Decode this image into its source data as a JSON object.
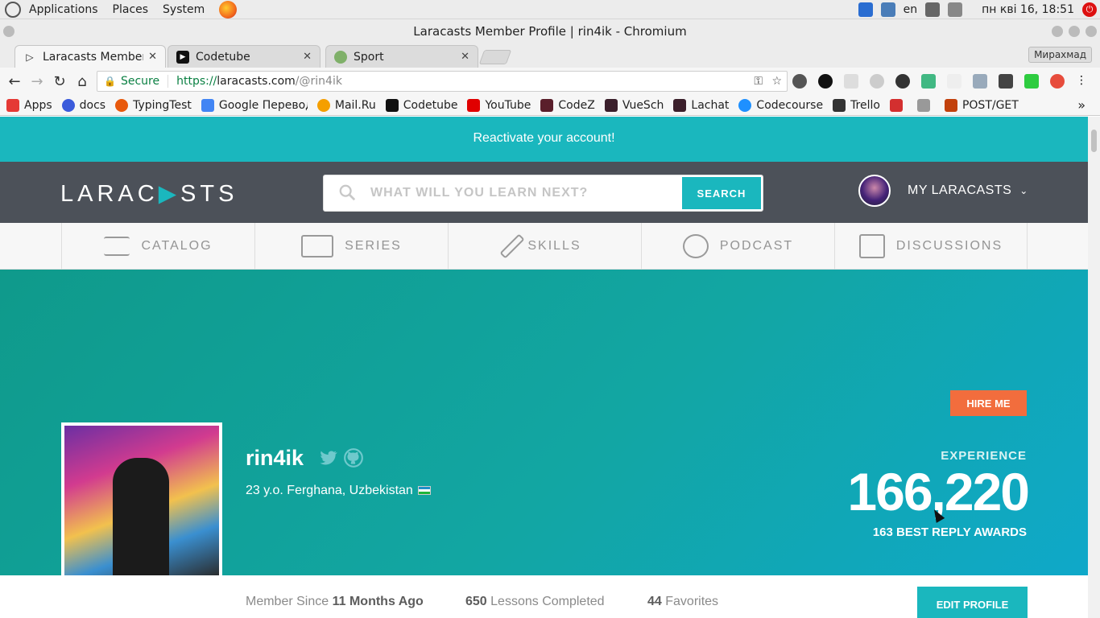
{
  "os": {
    "menus": [
      "Applications",
      "Places",
      "System"
    ],
    "keyboard_layout": "en",
    "datetime": "пн кві 16, 18:51"
  },
  "window": {
    "title": "Laracasts Member Profile | rin4ik - Chromium"
  },
  "tabs": [
    {
      "label": "Laracasts Member P",
      "icon": "laracasts-icon",
      "active": true
    },
    {
      "label": "Codetube",
      "icon": "youtube-icon",
      "active": false
    },
    {
      "label": "Sport",
      "icon": "sport-icon",
      "active": false
    }
  ],
  "profile_chip": "Мирахмад",
  "address_bar": {
    "secure_label": "Secure",
    "scheme": "https://",
    "host": "laracasts.com",
    "path": "/@rin4ik"
  },
  "bookmarks": [
    {
      "label": "Apps",
      "icon": "apps-icon",
      "color": "#e53935"
    },
    {
      "label": "docs",
      "icon": "docs-icon",
      "color": "#3b5bdb"
    },
    {
      "label": "TypingTest",
      "icon": "typingtest-icon",
      "color": "#e8590c"
    },
    {
      "label": "Google Перевод",
      "icon": "translate-icon",
      "color": "#4285f4"
    },
    {
      "label": "Mail.Ru",
      "icon": "mailru-icon",
      "color": "#f59f00"
    },
    {
      "label": "Codetube",
      "icon": "codetube-icon",
      "color": "#111111"
    },
    {
      "label": "YouTube",
      "icon": "youtube-icon",
      "color": "#e00000"
    },
    {
      "label": "CodeZ",
      "icon": "hash-icon",
      "color": "#5a1f2b"
    },
    {
      "label": "VueSch",
      "icon": "hash-icon",
      "color": "#3b1f2b"
    },
    {
      "label": "Lachat",
      "icon": "hash-icon",
      "color": "#3b1f2b"
    },
    {
      "label": "Codecourse",
      "icon": "codecourse-icon",
      "color": "#1e90ff"
    },
    {
      "label": "Trello",
      "icon": "trello-icon",
      "color": "#333333"
    },
    {
      "label": "",
      "icon": "red-bookmark-icon",
      "color": "#d32f2f"
    },
    {
      "label": "",
      "icon": "pdf-bookmark-icon",
      "color": "#999999"
    },
    {
      "label": "POST/GET",
      "icon": "postget-icon",
      "color": "#c2410c"
    }
  ],
  "site": {
    "notice": "Reactivate your account!",
    "logo_left": "LARAC",
    "logo_mid": "▶",
    "logo_right": "STS",
    "search_placeholder": "WHAT WILL YOU LEARN NEXT?",
    "search_button": "SEARCH",
    "user_menu": "MY LARACASTS",
    "accent_color": "#1ab7be",
    "nav": [
      {
        "label": "CATALOG",
        "icon": "list-icon"
      },
      {
        "label": "SERIES",
        "icon": "series-icon"
      },
      {
        "label": "SKILLS",
        "icon": "skills-icon"
      },
      {
        "label": "PODCAST",
        "icon": "podcast-icon"
      },
      {
        "label": "DISCUSSIONS",
        "icon": "discussions-icon"
      }
    ]
  },
  "profile": {
    "hire_button": "HIRE ME",
    "username": "rin4ik",
    "location": "23 y.o. Ferghana, Uzbekistan",
    "experience_label": "EXPERIENCE",
    "experience_value": "166,220",
    "awards": "163 BEST REPLY AWARDS",
    "member_since_label": "Member Since",
    "member_since_value": "11 Months Ago",
    "lessons_value": "650",
    "lessons_label": "Lessons Completed",
    "favorites_value": "44",
    "favorites_label": "Favorites",
    "edit_button": "EDIT PROFILE"
  }
}
